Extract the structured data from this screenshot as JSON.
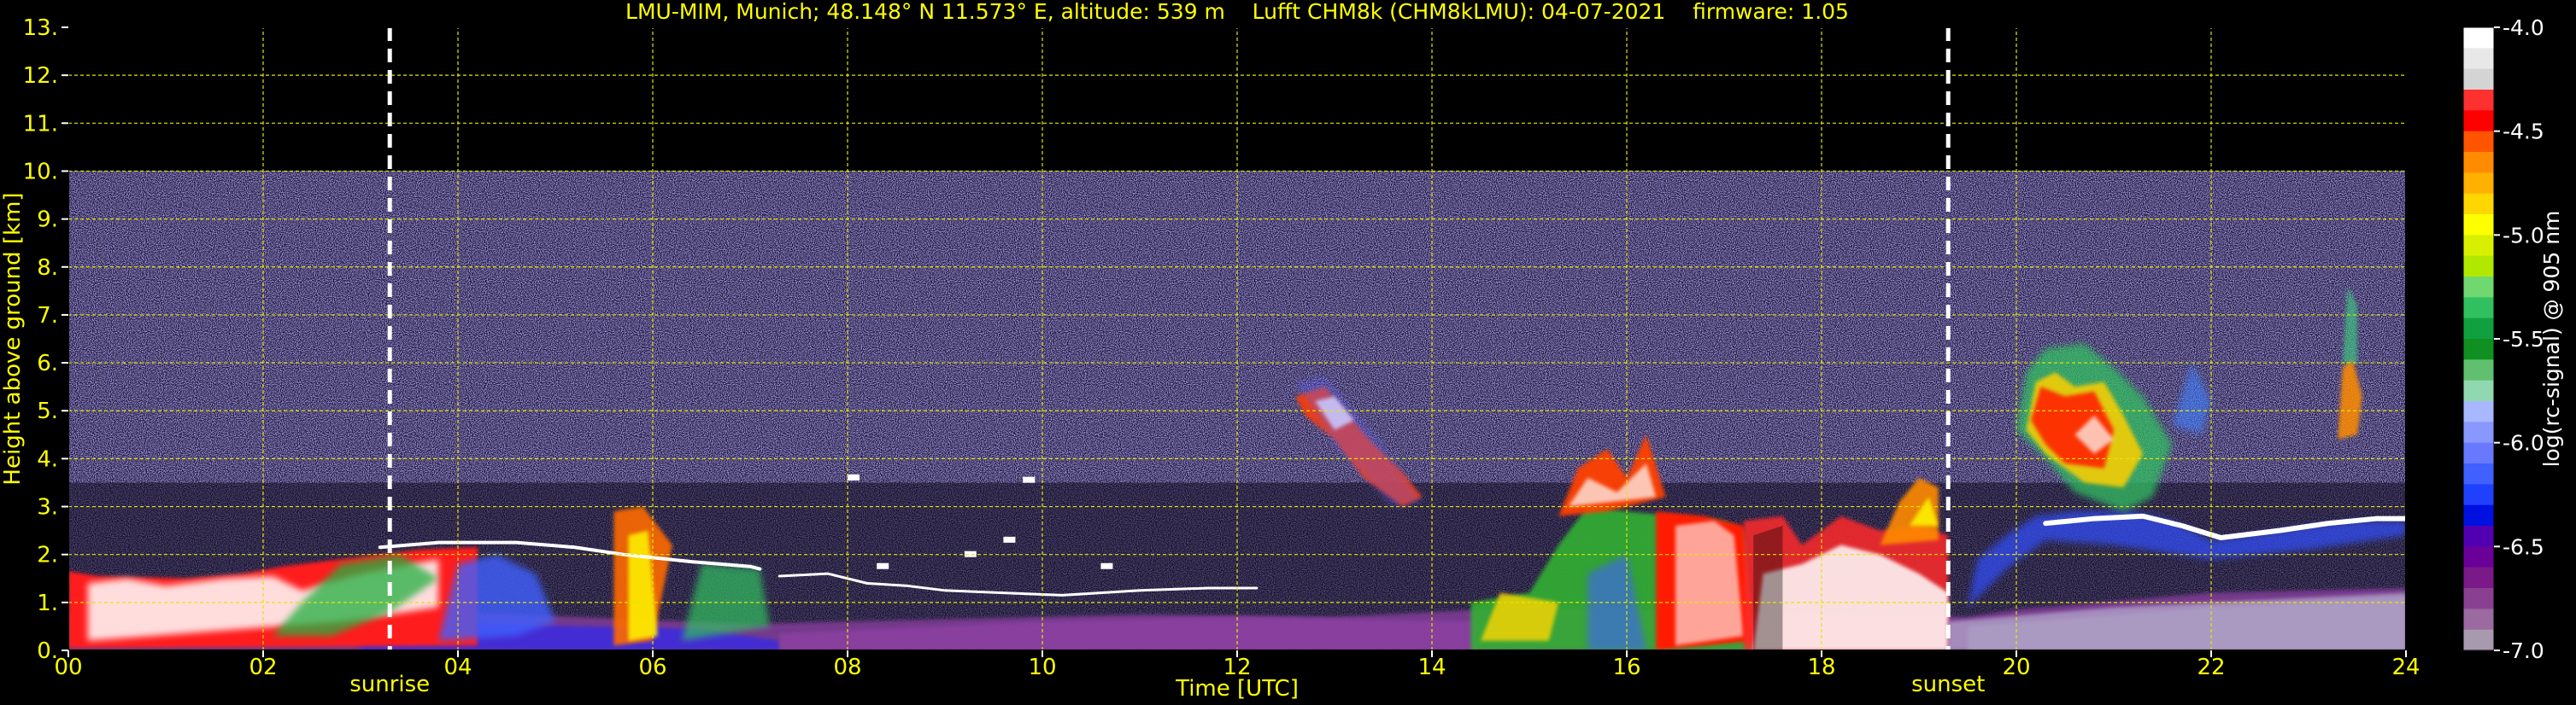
{
  "title": "LMU-MIM, Munich; 48.148° N 11.573° E, altitude: 539 m    Lufft CHM8k (CHM8kLMU): 04-07-2021    firmware: 1.05",
  "chart_data": {
    "type": "heatmap",
    "xlabel": "Time [UTC]",
    "ylabel": "Height above ground [km]",
    "xlim": [
      0,
      24
    ],
    "ylim": [
      0,
      13
    ],
    "x_ticks": [
      "00",
      "02",
      "04",
      "06",
      "08",
      "10",
      "12",
      "14",
      "16",
      "18",
      "20",
      "22",
      "24"
    ],
    "y_ticks": [
      "0.",
      "1.",
      "2.",
      "3.",
      "4.",
      "5.",
      "6.",
      "7.",
      "8.",
      "9.",
      "10.",
      "11.",
      "12.",
      "13."
    ],
    "grid": true,
    "grid_color": "#e6e600",
    "signal_top_km": 10,
    "markers": [
      {
        "label": "sunrise",
        "time": 3.3
      },
      {
        "label": "sunset",
        "time": 19.3
      }
    ],
    "colorbar": {
      "label": "log(rc-signal) @ 905 nm",
      "range": [
        -7.0,
        -4.0
      ],
      "ticks": [
        "-4.0",
        "-4.5",
        "-5.0",
        "-5.5",
        "-6.0",
        "-6.5",
        "-7.0"
      ],
      "colors": [
        "#ffffff",
        "#e8e8e8",
        "#d4d4d4",
        "#ff3030",
        "#ff0000",
        "#ff5500",
        "#ff8c00",
        "#ffb000",
        "#ffd700",
        "#ffff00",
        "#d8f000",
        "#b0e800",
        "#70d870",
        "#30c060",
        "#10a040",
        "#109020",
        "#60c070",
        "#90d8b0",
        "#a8b8ff",
        "#8898ff",
        "#6878ff",
        "#4060ff",
        "#2040ff",
        "#0010e0",
        "#5000b0",
        "#6a0098",
        "#7a1a88",
        "#8a4090",
        "#9a6aa0",
        "#a89aae"
      ]
    },
    "features": [
      {
        "name": "boundary layer aerosol",
        "x": [
          0,
          19.3
        ],
        "y": [
          0,
          2.2
        ]
      },
      {
        "name": "cloud layer",
        "x": [
          7.3,
          11.5
        ],
        "y": [
          1.1,
          1.5
        ]
      },
      {
        "name": "mid-level clouds",
        "x": [
          12.5,
          14.0
        ],
        "y": [
          3.0,
          5.5
        ]
      },
      {
        "name": "cloud with precipitation",
        "x": [
          15.0,
          19.3
        ],
        "y": [
          0,
          4.5
        ]
      },
      {
        "name": "convective cloud",
        "x": [
          20.0,
          22.0
        ],
        "y": [
          2.5,
          6.5
        ]
      },
      {
        "name": "stratocumulus layer",
        "x": [
          21.0,
          24.0
        ],
        "y": [
          2.2,
          2.8
        ]
      },
      {
        "name": "high cloud",
        "x": [
          23.3,
          23.5
        ],
        "y": [
          4.5,
          7.5
        ]
      }
    ]
  }
}
